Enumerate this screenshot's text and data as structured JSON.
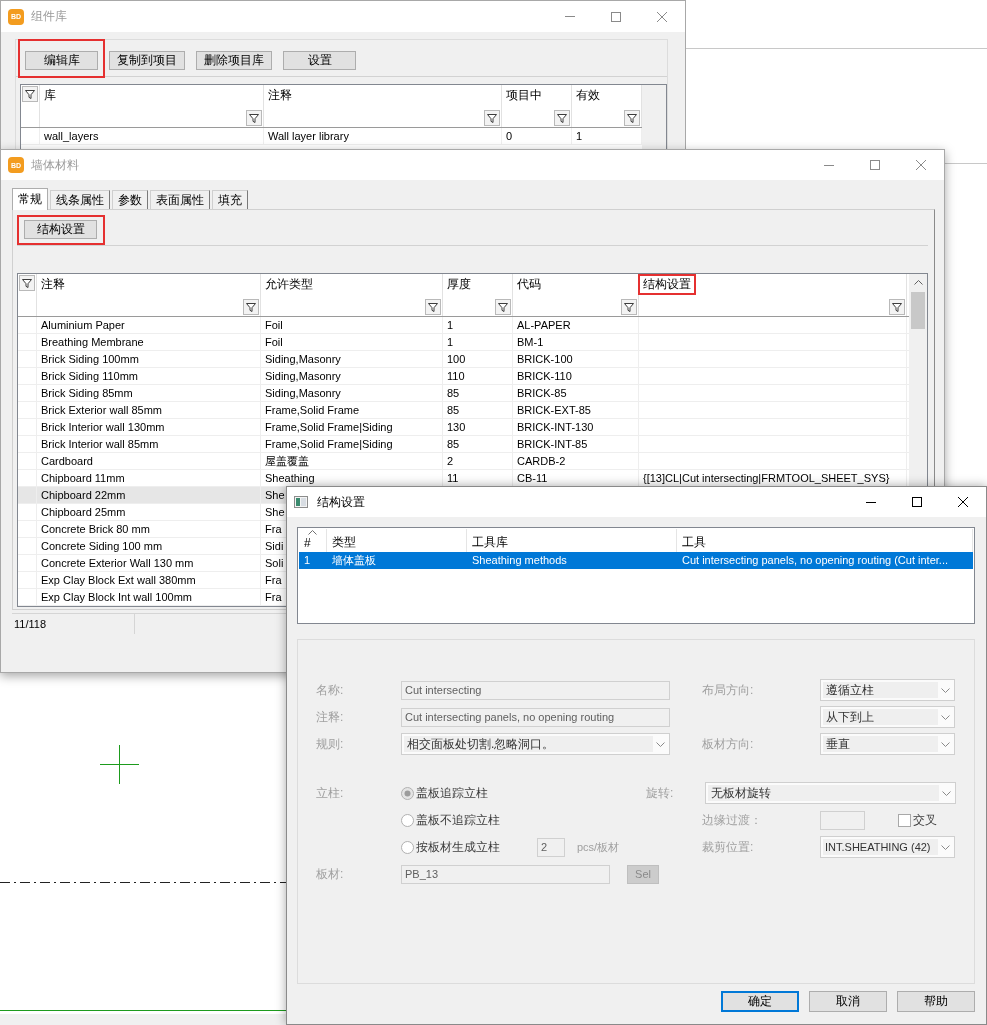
{
  "component_library_window": {
    "logo": "BD",
    "title": "组件库",
    "active": false,
    "buttons": [
      {
        "label": "编辑库",
        "highlighted": true
      },
      {
        "label": "复制到项目",
        "highlighted": false
      },
      {
        "label": "删除项目库",
        "highlighted": false
      },
      {
        "label": "设置",
        "highlighted": false
      }
    ],
    "table": {
      "columns": [
        {
          "label": "库"
        },
        {
          "label": "注释"
        },
        {
          "label": "项目中"
        },
        {
          "label": "有效"
        }
      ],
      "rows": [
        {
          "selected": false,
          "cells": [
            "wall_layers",
            "Wall layer library",
            "0",
            "1"
          ]
        }
      ]
    }
  },
  "wall_material_window": {
    "logo": "BD",
    "title": "墙体材料",
    "active": false,
    "tabs": [
      {
        "label": "常规",
        "selected": true
      },
      {
        "label": "线条属性",
        "selected": false
      },
      {
        "label": "参数",
        "selected": false
      },
      {
        "label": "表面属性",
        "selected": false
      },
      {
        "label": "填充",
        "selected": false
      }
    ],
    "buttons": [
      {
        "label": "结构设置",
        "highlighted": true
      }
    ],
    "table": {
      "columns": [
        {
          "label": "注释",
          "highlighted": false
        },
        {
          "label": "允许类型",
          "highlighted": false
        },
        {
          "label": "厚度",
          "highlighted": false
        },
        {
          "label": "代码",
          "highlighted": false
        },
        {
          "label": "结构设置",
          "highlighted": true
        }
      ],
      "rows": [
        {
          "selected": false,
          "cells": [
            "Aluminium Paper",
            "Foil",
            "1",
            "AL-PAPER"
          ]
        },
        {
          "selected": false,
          "cells": [
            "Breathing Membrane",
            "Foil",
            "1",
            "BM-1"
          ]
        },
        {
          "selected": false,
          "cells": [
            "Brick Siding 100mm",
            "Siding,Masonry",
            "100",
            "BRICK-100"
          ]
        },
        {
          "selected": false,
          "cells": [
            "Brick Siding 110mm",
            "Siding,Masonry",
            "110",
            "BRICK-110"
          ]
        },
        {
          "selected": false,
          "cells": [
            "Brick Siding 85mm",
            "Siding,Masonry",
            "85",
            "BRICK-85"
          ]
        },
        {
          "selected": false,
          "cells": [
            "Brick Exterior wall 85mm",
            "Frame,Solid Frame",
            "85",
            "BRICK-EXT-85"
          ]
        },
        {
          "selected": false,
          "cells": [
            "Brick Interior wall 130mm",
            "Frame,Solid Frame|Siding",
            "130",
            "BRICK-INT-130"
          ]
        },
        {
          "selected": false,
          "cells": [
            "Brick Interior wall 85mm",
            "Frame,Solid Frame|Siding",
            "85",
            "BRICK-INT-85"
          ]
        },
        {
          "selected": false,
          "cells": [
            "Cardboard",
            "屋盖覆盖",
            "2",
            "CARDB-2"
          ]
        },
        {
          "selected": false,
          "cells": [
            "Chipboard 11mm",
            "Sheathing",
            "11",
            "CB-11",
            "{[13]CL|Cut intersecting|FRMTOOL_SHEET_SYS}"
          ]
        },
        {
          "selected": true,
          "cells": [
            "Chipboard 22mm",
            "She"
          ]
        },
        {
          "selected": false,
          "cells": [
            "Chipboard 25mm",
            "She"
          ]
        },
        {
          "selected": false,
          "cells": [
            "Concrete Brick 80 mm",
            "Fra"
          ]
        },
        {
          "selected": false,
          "cells": [
            "Concrete Siding 100 mm",
            "Sidi"
          ]
        },
        {
          "selected": false,
          "cells": [
            "Concrete Exterior Wall 130 mm",
            "Soli"
          ]
        },
        {
          "selected": false,
          "cells": [
            "Exp Clay Block Ext wall 380mm",
            "Fra"
          ]
        },
        {
          "selected": false,
          "cells": [
            "Exp Clay Block Int wall 100mm",
            "Fra"
          ]
        }
      ]
    },
    "status_bar": {
      "count": "11/118"
    }
  },
  "structure_settings_window": {
    "title": "结构设置",
    "active": true,
    "list": {
      "columns": [
        {
          "label": "#",
          "sorted": true
        },
        {
          "label": "类型",
          "sorted": false
        },
        {
          "label": "工具库",
          "sorted": false
        },
        {
          "label": "工具",
          "sorted": false
        }
      ],
      "rows": [
        {
          "selected": true,
          "cells": [
            "1",
            "墙体盖板",
            "Sheathing methods",
            "Cut intersecting panels, no opening routing (Cut inter..."
          ]
        }
      ]
    },
    "form": {
      "disabled": true,
      "name": {
        "label": "名称:",
        "value": "Cut intersecting"
      },
      "layout_direction": {
        "label": "布局方向:",
        "value": "遵循立柱"
      },
      "comment": {
        "label": "注释:",
        "value": "Cut intersecting panels, no opening routing"
      },
      "layout_order": {
        "value": "从下到上"
      },
      "rule": {
        "label": "规则:",
        "value": "相交面板处切割.忽略洞口。"
      },
      "panel_direction": {
        "label": "板材方向:",
        "value": "垂直"
      },
      "stud": {
        "label": "立柱:",
        "options": [
          {
            "label": "盖板追踪立柱",
            "selected": true
          },
          {
            "label": "盖板不追踪立柱",
            "selected": false
          },
          {
            "label": "按板材生成立柱",
            "selected": false
          }
        ]
      },
      "rotation": {
        "label": "旋转:",
        "value": "无板材旋转"
      },
      "edge_transition": {
        "label": "边缘过渡："
      },
      "cross": {
        "label": "交叉",
        "checked": false
      },
      "studs_per_panel": {
        "value": "2",
        "unit": "pcs/板材"
      },
      "cut_position": {
        "label": "裁剪位置:",
        "value": "INT.SHEATHING (42)"
      },
      "board": {
        "label": "板材:",
        "value": "PB_13",
        "button": "Sel"
      }
    },
    "buttons": [
      {
        "label": "确定",
        "default": true
      },
      {
        "label": "取消",
        "default": false
      },
      {
        "label": "帮助",
        "default": false
      }
    ]
  }
}
